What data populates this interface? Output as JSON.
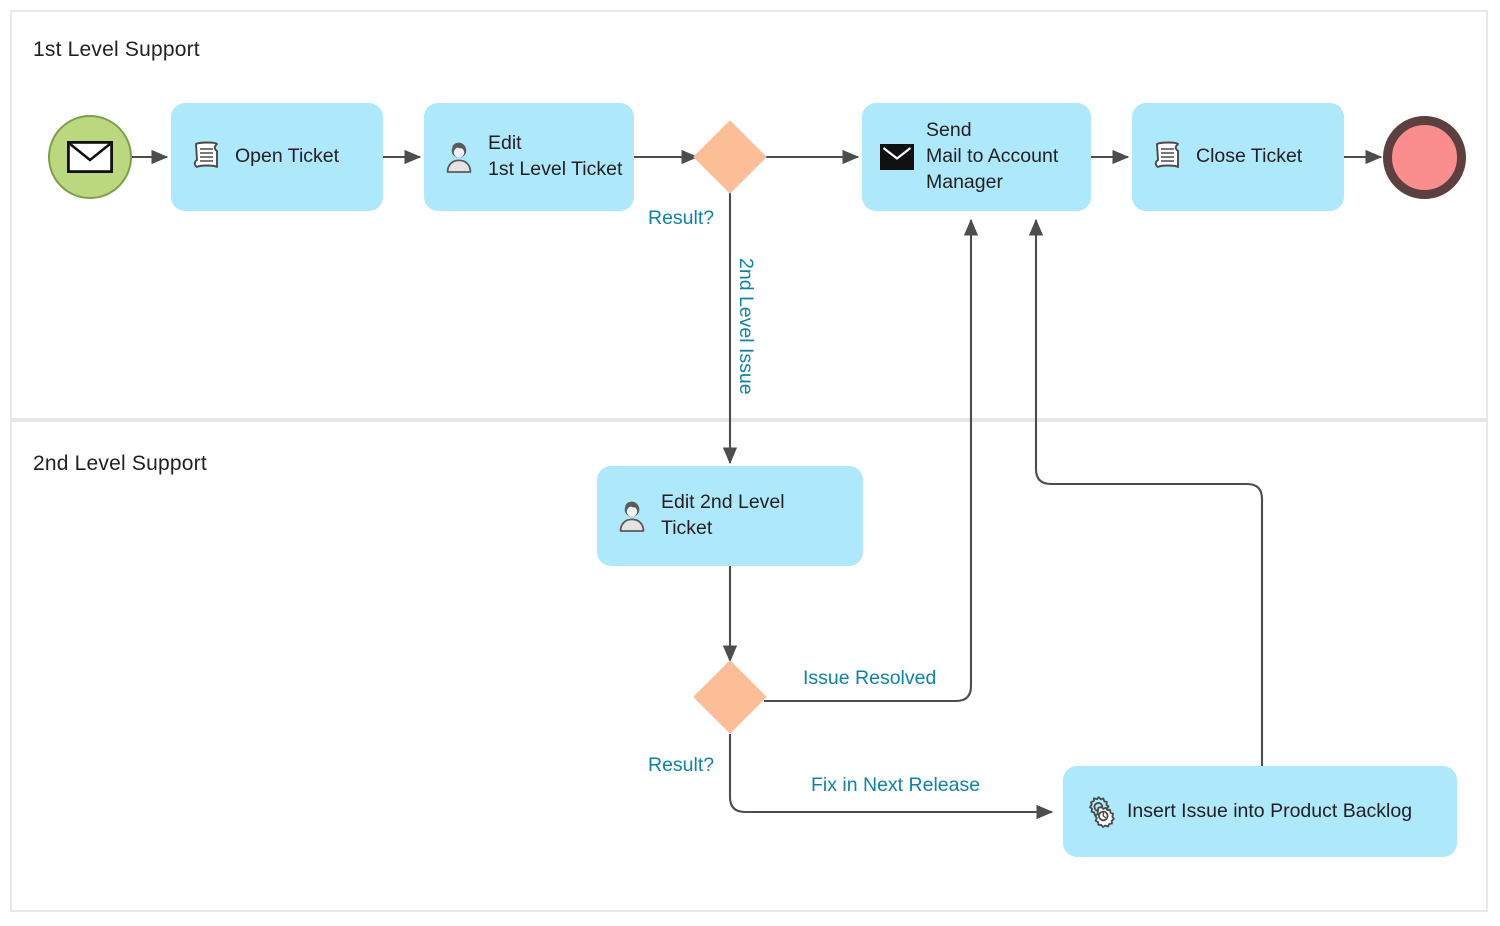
{
  "diagram": {
    "title_visible": false,
    "colors": {
      "task_fill": "#ade8fb",
      "gateway_fill": "#fcbe96",
      "start_event_fill": "#bcd87f",
      "start_event_stroke": "#7f9e4a",
      "end_event_fill": "#fa8d8d",
      "end_event_stroke": "#5c4040",
      "edge_stroke": "#4d4d4d",
      "edge_label_color": "#0b84a8",
      "text_color": "#231f20",
      "lane_divider": "#e6e6e6",
      "frame_border": "#e8e8e8"
    }
  },
  "lanes": [
    {
      "id": "lane-1",
      "title": "1st Level Support"
    },
    {
      "id": "lane-2",
      "title": "2nd Level Support"
    }
  ],
  "events": [
    {
      "id": "start-event",
      "type": "message-start-event",
      "icon": "envelope-icon",
      "label": ""
    },
    {
      "id": "end-event",
      "type": "end-event",
      "icon": "",
      "label": ""
    }
  ],
  "tasks": [
    {
      "id": "task-open-ticket",
      "label": "Open Ticket",
      "icon": "script-icon"
    },
    {
      "id": "task-edit-1st",
      "label": "Edit\n1st Level Ticket",
      "icon": "user-icon"
    },
    {
      "id": "task-send-mail",
      "label": "Send\nMail to Account\nManager",
      "icon": "envelope-filled-icon"
    },
    {
      "id": "task-close-ticket",
      "label": "Close Ticket",
      "icon": "script-icon"
    },
    {
      "id": "task-edit-2nd",
      "label": "Edit 2nd Level\nTicket",
      "icon": "user-icon"
    },
    {
      "id": "task-insert-backlog",
      "label": "Insert Issue into Product Backlog",
      "icon": "gears-icon"
    }
  ],
  "gateways": [
    {
      "id": "gateway-1",
      "label": "Result?"
    },
    {
      "id": "gateway-2",
      "label": "Result?"
    }
  ],
  "edge_labels": [
    {
      "id": "edge-label-2nd-level-issue",
      "text": "2nd Level Issue",
      "orientation": "vertical"
    },
    {
      "id": "edge-label-issue-resolved",
      "text": "Issue Resolved",
      "orientation": "horizontal"
    },
    {
      "id": "edge-label-fix-next-release",
      "text": "Fix in Next Release",
      "orientation": "horizontal"
    }
  ],
  "flow": {
    "description": "BPMN ticket handling process across 1st and 2nd level support lanes",
    "sequence": [
      "start-event -> task-open-ticket",
      "task-open-ticket -> task-edit-1st",
      "task-edit-1st -> gateway-1",
      "gateway-1 -> task-send-mail",
      "gateway-1 -> task-edit-2nd (2nd Level Issue)",
      "task-send-mail -> task-close-ticket",
      "task-close-ticket -> end-event",
      "task-edit-2nd -> gateway-2",
      "gateway-2 -> task-send-mail (Issue Resolved)",
      "gateway-2 -> task-insert-backlog (Fix in Next Release)",
      "task-insert-backlog -> task-send-mail"
    ]
  }
}
